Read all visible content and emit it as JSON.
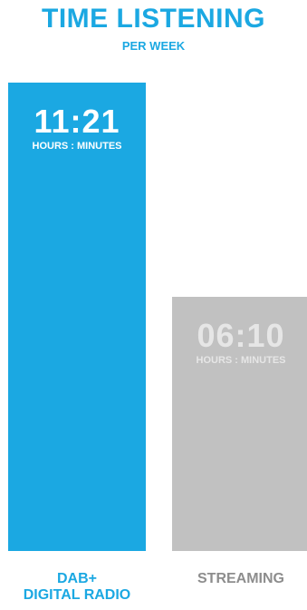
{
  "colors": {
    "dab": "#1ba8e2",
    "streaming": "#c1c1c1",
    "streaming_text": "#e6e6e6",
    "streaming_label": "#8d8d8d"
  },
  "chart_data": {
    "type": "bar",
    "title": "TIME LISTENING",
    "subtitle": "PER WEEK",
    "categories": [
      "DAB+\nDIGITAL RADIO",
      "STREAMING"
    ],
    "category_lines": [
      [
        "DAB+",
        "DIGITAL RADIO"
      ],
      [
        "STREAMING"
      ]
    ],
    "values_minutes": [
      681,
      370
    ],
    "value_labels": [
      "11:21",
      "06:10"
    ],
    "unit_label": "HOURS : MINUTES",
    "series_colors": [
      "#1ba8e2",
      "#c1c1c1"
    ],
    "ylim": [
      0,
      681
    ]
  }
}
